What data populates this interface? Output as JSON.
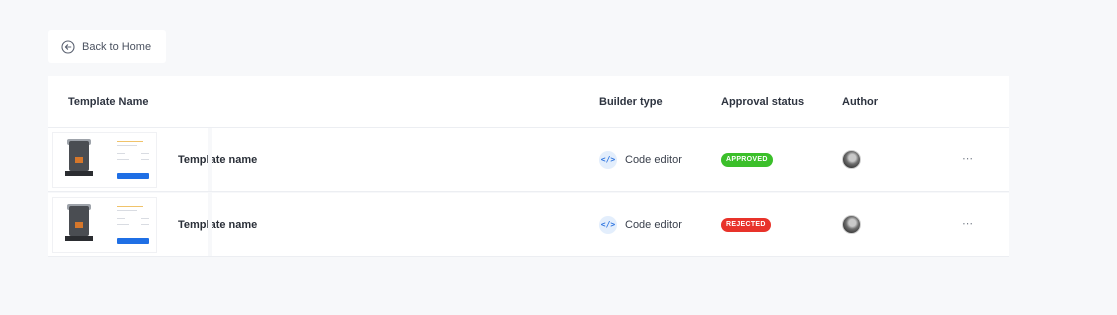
{
  "back_button": {
    "label": "Back to Home",
    "icon": "arrow-left-circle-icon"
  },
  "table": {
    "columns": {
      "name": "Template Name",
      "builder": "Builder type",
      "status": "Approval status",
      "author": "Author"
    },
    "rows": [
      {
        "name": "Template name",
        "builder": "Code editor",
        "builder_icon": "</>",
        "status": "APPROVED",
        "status_color": "#3bbf2a",
        "menu": "⋯"
      },
      {
        "name": "Template name",
        "builder": "Code editor",
        "builder_icon": "</>",
        "status": "REJECTED",
        "status_color": "#e8332a",
        "menu": "⋯"
      }
    ]
  },
  "colors": {
    "background": "#f7f8fa",
    "accent_blue": "#1f6fe5"
  }
}
